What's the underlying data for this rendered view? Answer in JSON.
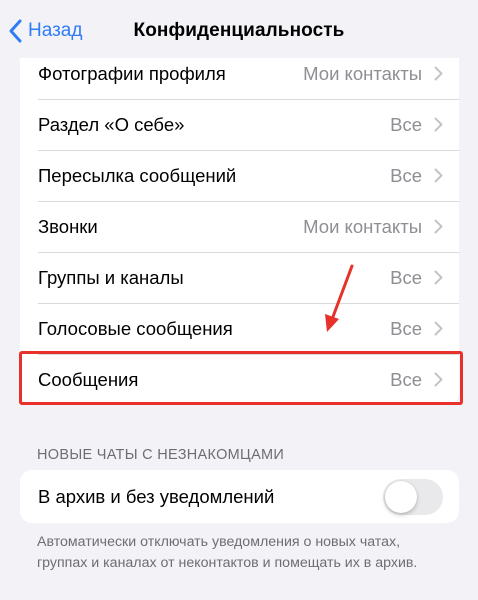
{
  "navbar": {
    "back_label": "Назад",
    "title": "Конфиденциальность"
  },
  "privacy_rows": [
    {
      "label": "Фотографии профиля",
      "value": "Мои контакты"
    },
    {
      "label": "Раздел «О себе»",
      "value": "Все"
    },
    {
      "label": "Пересылка сообщений",
      "value": "Все"
    },
    {
      "label": "Звонки",
      "value": "Мои контакты"
    },
    {
      "label": "Группы и каналы",
      "value": "Все"
    },
    {
      "label": "Голосовые сообщения",
      "value": "Все"
    },
    {
      "label": "Сообщения",
      "value": "Все",
      "highlighted": true
    }
  ],
  "new_chats": {
    "header": "НОВЫЕ ЧАТЫ С НЕЗНАКОМЦАМИ",
    "toggle_label": "В архив и без уведомлений",
    "toggle_on": false,
    "footer": "Автоматически отключать уведомления о новых чатах, группах и каналах от неконтактов и помещать их в архив."
  },
  "colors": {
    "accent": "#2f7cf6",
    "highlight": "#e8312b",
    "secondary_text": "#8e8e93",
    "background": "#f2f2f7"
  },
  "icons": {
    "back": "chevron-left-icon",
    "row": "chevron-right-icon",
    "annotation": "red-arrow-icon"
  }
}
